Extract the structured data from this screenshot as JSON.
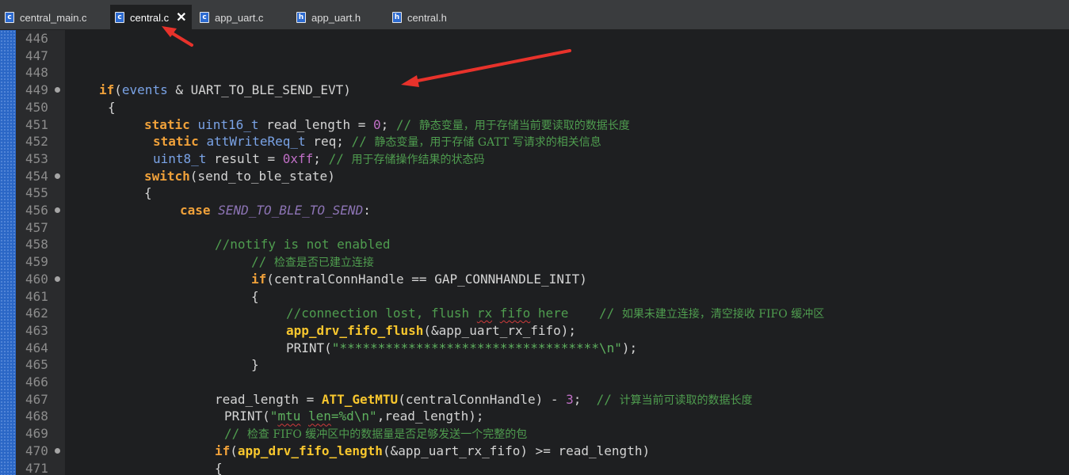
{
  "tabs": [
    {
      "label": "central_main.c",
      "icon": "c-file-icon",
      "icon_letter": "c",
      "active": false
    },
    {
      "label": "central.c",
      "icon": "c-file-icon",
      "icon_letter": "c",
      "active": true,
      "close": "✕"
    },
    {
      "label": "app_uart.c",
      "icon": "c-file-icon",
      "icon_letter": "c",
      "active": false
    },
    {
      "label": "app_uart.h",
      "icon": "h-file-icon",
      "icon_letter": "h",
      "active": false
    },
    {
      "label": "central.h",
      "icon": "h-file-icon",
      "icon_letter": "h",
      "active": false
    }
  ],
  "editor": {
    "line_numbers": [
      "446",
      "447",
      "448",
      "449",
      "450",
      "451",
      "452",
      "453",
      "454",
      "455",
      "456",
      "457",
      "458",
      "459",
      "460",
      "461",
      "462",
      "463",
      "464",
      "465",
      "466",
      "467",
      "468",
      "469",
      "470",
      "471"
    ],
    "fold_markers": [
      "449",
      "454",
      "456",
      "460",
      "470"
    ],
    "code": {
      "l449": {
        "kw": "if",
        "p1": "(",
        "v1": "events",
        "p2": " & UART_TO_BLE_SEND_EVT)"
      },
      "l450": {
        "t": "{"
      },
      "l451": {
        "kw": "static",
        "ty": "uint16_t",
        "p": " read_length = ",
        "num": "0",
        "p2": ";",
        "cm": " // ",
        "cz": "静态变量，用于存储当前要读取的数据长度"
      },
      "l452": {
        "kw": "static",
        "ty": "attWriteReq_t",
        "p": " req;",
        "cm": " // ",
        "cz": "静态变量，用于存储 GATT 写请求的相关信息"
      },
      "l453": {
        "ty": "uint8_t",
        "p": " result = ",
        "num": "0xff",
        "p2": ";",
        "cm": " // ",
        "cz": "用于存储操作结果的状态码"
      },
      "l454": {
        "kw": "switch",
        "p": "(send_to_ble_state)"
      },
      "l455": {
        "t": "{"
      },
      "l456": {
        "kw": "case",
        "en": "SEND_TO_BLE_TO_SEND",
        "p": ":"
      },
      "l458": {
        "cm": "//notify is not enabled"
      },
      "l459": {
        "cm": "// ",
        "cz": "检查是否已建立连接"
      },
      "l460": {
        "kw": "if",
        "p": "(centralConnHandle == GAP_CONNHANDLE_INIT)"
      },
      "l461": {
        "t": "{"
      },
      "l462": {
        "cm1": "//connection lost, flush ",
        "sq1": "rx",
        "cm2": " ",
        "sq2": "fifo",
        "cm3": " here    // ",
        "cz": "如果未建立连接，清空接收 FIFO 缓冲区"
      },
      "l463": {
        "fn": "app_drv_fifo_flush",
        "p": "(&app_uart_rx_fifo);"
      },
      "l464": {
        "p1": "PRINT(",
        "s": "\"**********************************\\n\"",
        "p2": ");"
      },
      "l465": {
        "t": "}"
      },
      "l467": {
        "p": "read_length = ",
        "fn": "ATT_GetMTU",
        "p2": "(centralConnHandle) - ",
        "num": "3",
        "p3": ";",
        "cm": "  // ",
        "cz": "计算当前可读取的数据长度"
      },
      "l468": {
        "p1": "PRINT(",
        "s1": "\"",
        "sq1": "mtu",
        "s2": " ",
        "sq2": "len",
        "s3": "=%d\\n\"",
        "p2": ",read_length);"
      },
      "l469": {
        "cm": "// ",
        "cz": "检查 FIFO 缓冲区中的数据量是否足够发送一个完整的包"
      },
      "l470": {
        "kw": "if",
        "p1": "(",
        "fn": "app_drv_fifo_length",
        "p2": "(&app_uart_rx_fifo) >= read_length)"
      },
      "l471": {
        "t": "{"
      }
    }
  }
}
